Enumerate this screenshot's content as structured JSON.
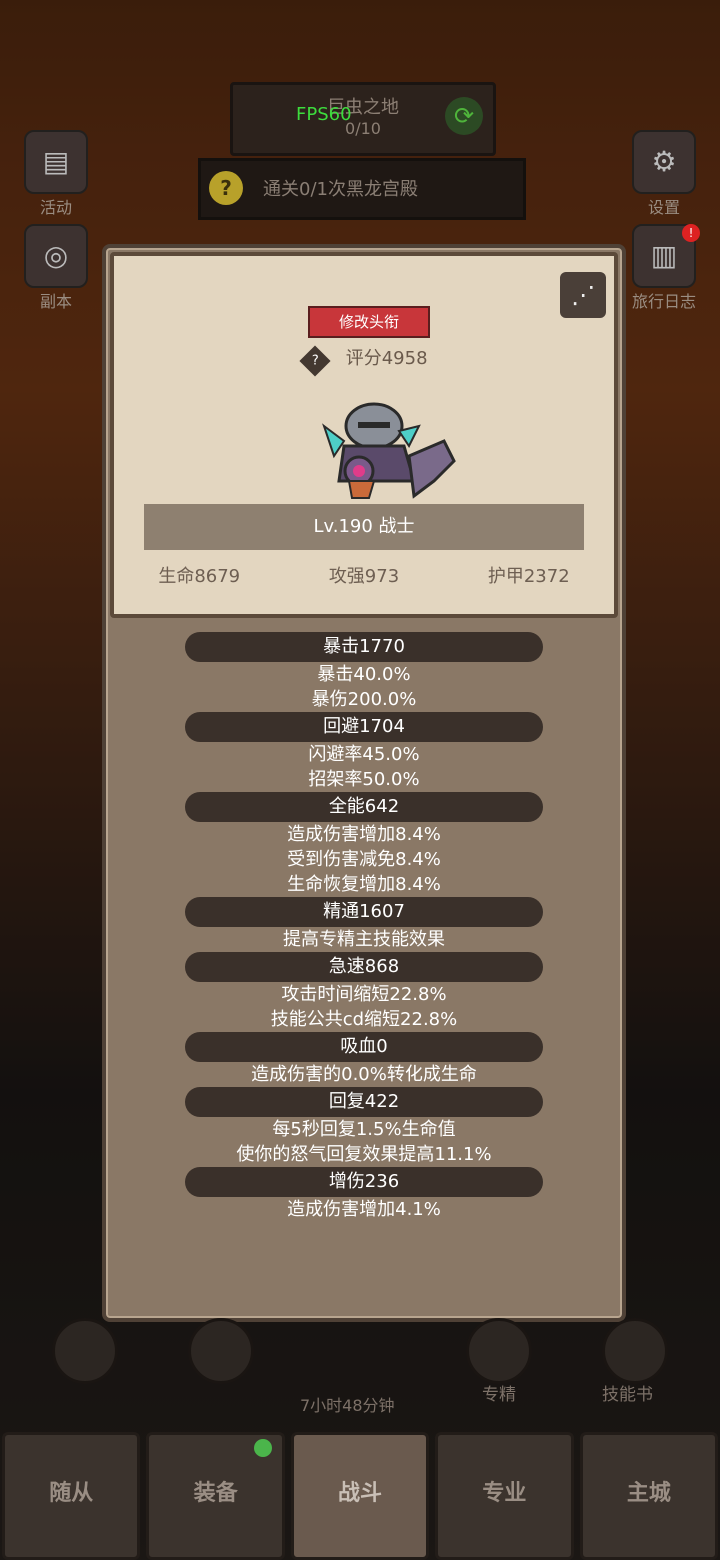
{
  "top": {
    "fps": "FPS60",
    "zone_title": "巨虫之地",
    "zone_progress": "0/10",
    "quest_text": "通关0/1次黑龙宫殿"
  },
  "side_left": [
    {
      "label": "活动",
      "icon": "event-book-icon"
    },
    {
      "label": "副本",
      "icon": "dungeon-portal-icon"
    }
  ],
  "side_right": [
    {
      "label": "设置",
      "icon": "gear-icon"
    },
    {
      "label": "旅行日志",
      "icon": "journal-icon",
      "badge": "!"
    }
  ],
  "panel": {
    "title_button": "修改头衔",
    "score": "评分4958",
    "level": "Lv.190 战士",
    "stats": {
      "hp": "生命8679",
      "atk": "攻强973",
      "armor": "护甲2372"
    }
  },
  "attributes": [
    {
      "head": "暴击1770",
      "lines": [
        "暴击40.0%",
        "暴伤200.0%"
      ]
    },
    {
      "head": "回避1704",
      "lines": [
        "闪避率45.0%",
        "招架率50.0%"
      ]
    },
    {
      "head": "全能642",
      "lines": [
        "造成伤害增加8.4%",
        "受到伤害减免8.4%",
        "生命恢复增加8.4%"
      ]
    },
    {
      "head": "精通1607",
      "lines": [
        "提高专精主技能效果"
      ]
    },
    {
      "head": "急速868",
      "lines": [
        "攻击时间缩短22.8%",
        "技能公共cd缩短22.8%"
      ]
    },
    {
      "head": "吸血0",
      "lines": [
        "造成伤害的0.0%转化成生命"
      ]
    },
    {
      "head": "回复422",
      "lines": [
        "每5秒回复1.5%生命值",
        "使你的怒气回复效果提高11.1%"
      ]
    },
    {
      "head": "增伤236",
      "lines": [
        "造成伤害增加4.1%"
      ]
    }
  ],
  "bottom": {
    "timer": "7小时48分钟",
    "spec_label": "专精",
    "skillbook_label": "技能书"
  },
  "tabs": [
    "随从",
    "装备",
    "战斗",
    "专业",
    "主城"
  ]
}
